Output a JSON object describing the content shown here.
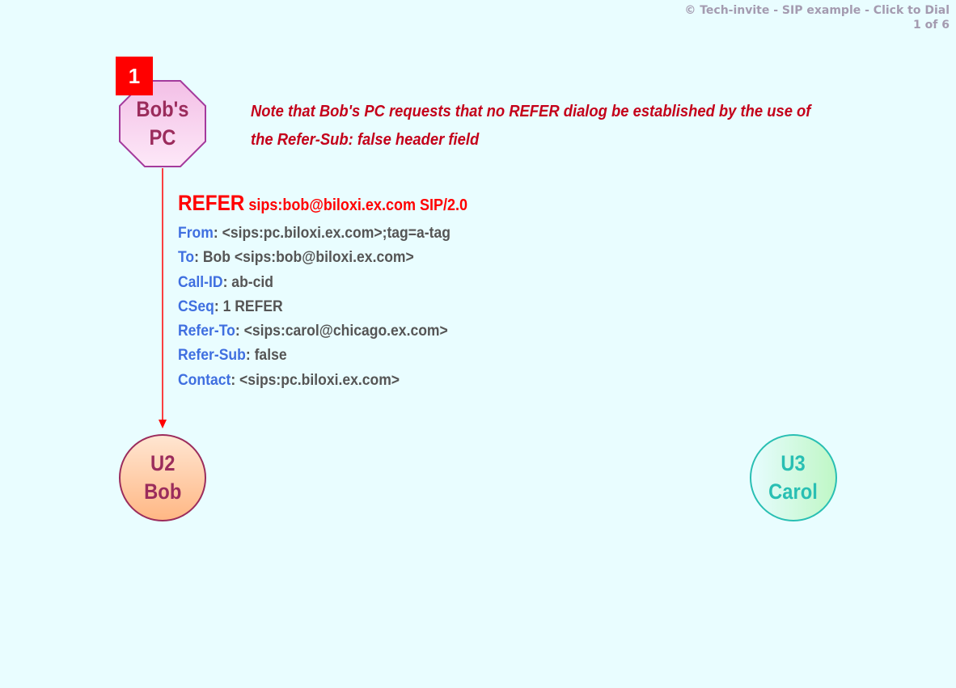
{
  "header": {
    "copyright_link": "© Tech-invite - SIP example - Click to Dial",
    "page_indicator": "1 of 6"
  },
  "step_badge": "1",
  "nodes": {
    "bobs_pc": {
      "line1": "Bob's",
      "line2": "PC",
      "shape": "octagon",
      "text_color": "#9b2c5c",
      "fill": "#fbd9f2",
      "stroke": "#9b2c8c"
    },
    "u2_bob": {
      "line1": "U2",
      "line2": "Bob",
      "shape": "circle",
      "text_color": "#9b2c5c",
      "fill": "#ffc79b",
      "stroke": "#9b2c5c"
    },
    "u3_carol": {
      "line1": "U3",
      "line2": "Carol",
      "shape": "circle",
      "text_color": "#29bfb3",
      "fill": "#c9f9d4",
      "stroke": "#29bfb3"
    }
  },
  "note": {
    "line1": "Note that Bob's PC requests that no REFER dialog be established by the use of",
    "line2": "the Refer-Sub: false header field"
  },
  "message": {
    "method": "REFER",
    "request_uri": " sips:bob@biloxi.ex.com SIP/2.0",
    "headers": [
      {
        "name": "From",
        "value": ": <sips:pc.biloxi.ex.com>;tag=a-tag"
      },
      {
        "name": "To",
        "value": ": Bob <sips:bob@biloxi.ex.com>"
      },
      {
        "name": "Call-ID",
        "value": ": ab-cid"
      },
      {
        "name": "CSeq",
        "value": ": 1 REFER"
      },
      {
        "name": "Refer-To",
        "value": ": <sips:carol@chicago.ex.com>"
      },
      {
        "name": "Refer-Sub",
        "value": ": false"
      },
      {
        "name": "Contact",
        "value": ": <sips:pc.biloxi.ex.com>"
      }
    ],
    "arrow_color": "#ff0000",
    "from_node": "Bob's PC",
    "to_node": "U2 Bob"
  }
}
